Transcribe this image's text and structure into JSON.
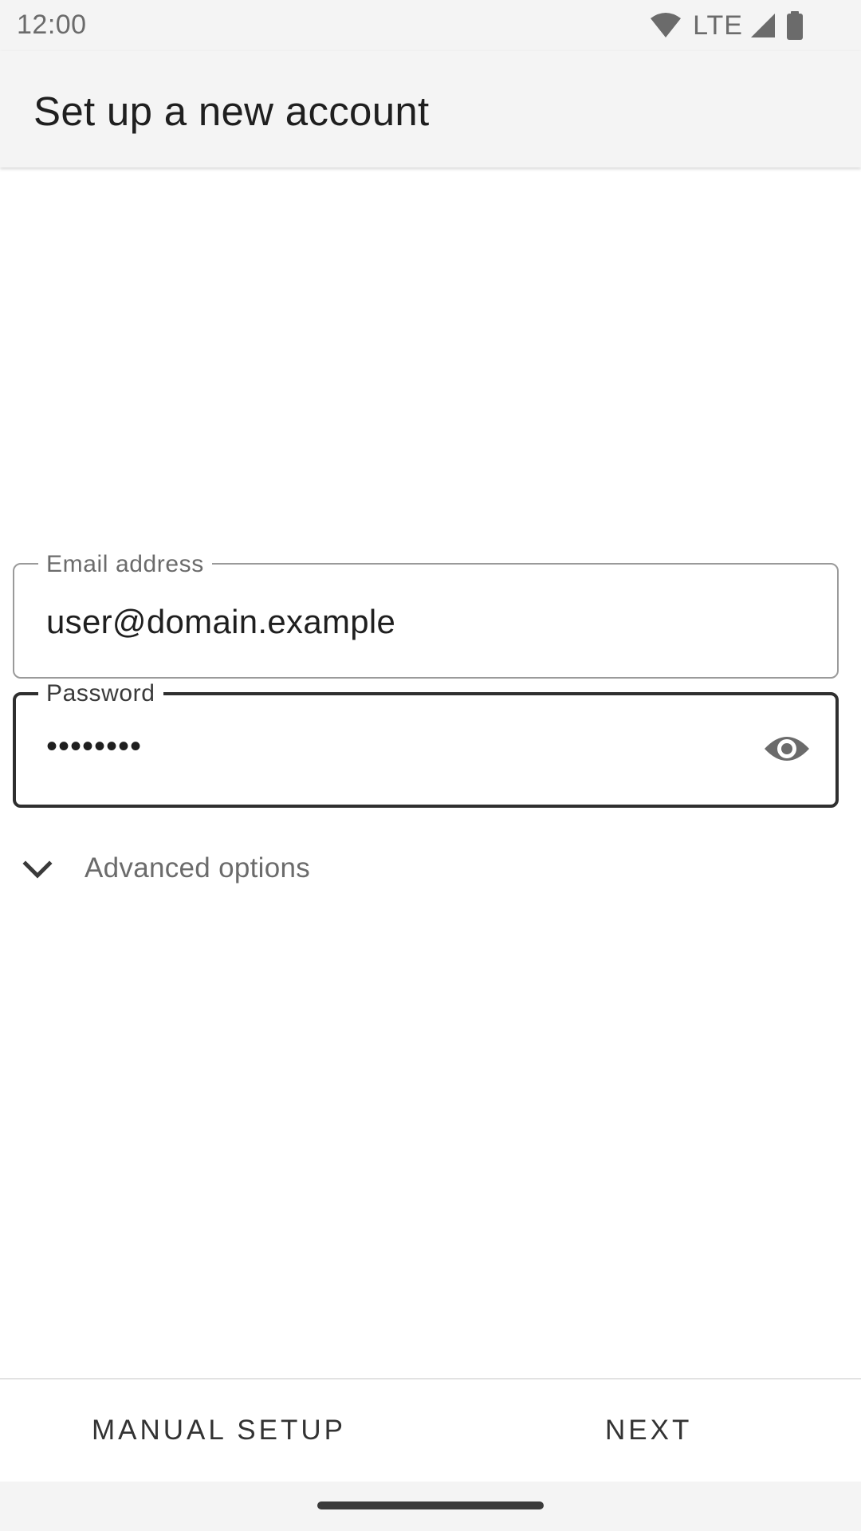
{
  "status_bar": {
    "time": "12:00",
    "network": "LTE",
    "icons": [
      "wifi-icon",
      "cellular-signal-icon",
      "battery-icon"
    ]
  },
  "app_bar": {
    "title": "Set up a new account"
  },
  "form": {
    "email": {
      "label": "Email address",
      "value": "user@domain.example"
    },
    "password": {
      "label": "Password",
      "value": "••••••••",
      "toggle_icon": "eye-icon"
    },
    "advanced": {
      "label": "Advanced options",
      "icon": "chevron-down-icon"
    }
  },
  "actions": {
    "manual_setup": "MANUAL SETUP",
    "next": "NEXT"
  },
  "colors": {
    "bar_background": "#f4f4f4",
    "text_primary": "#1f1f1f",
    "text_secondary": "#6b6b6b",
    "focused_outline": "#2f2f2f"
  }
}
